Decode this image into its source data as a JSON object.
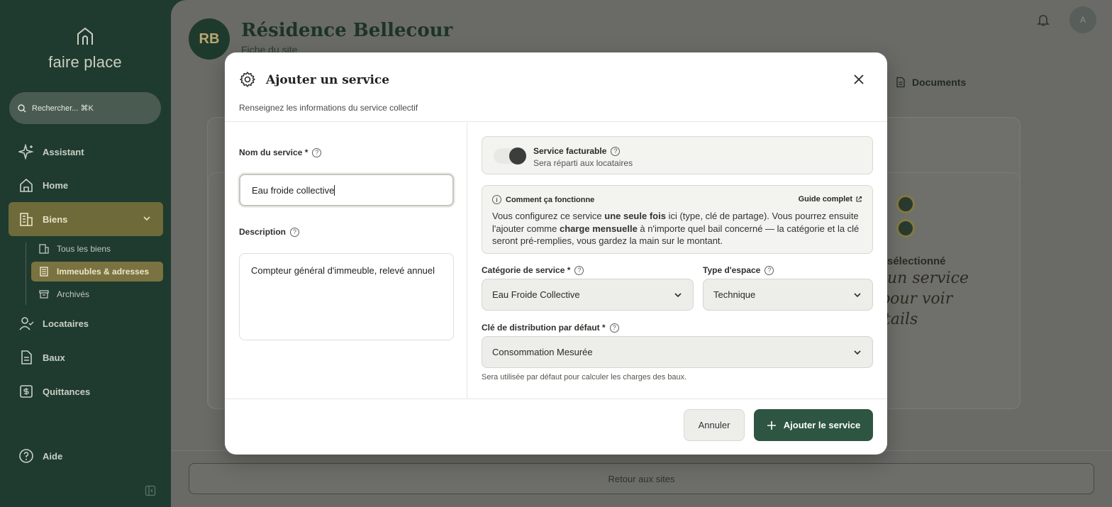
{
  "sidebar": {
    "logo_text": "faire place",
    "search_placeholder": "Rechercher... ⌘K",
    "nav": [
      {
        "label": "Assistant",
        "icon": "sparkle-icon"
      },
      {
        "label": "Home",
        "icon": "home-icon"
      },
      {
        "label": "Biens",
        "icon": "building-icon"
      },
      {
        "label": "Locataires",
        "icon": "user-icon"
      },
      {
        "label": "Baux",
        "icon": "document-icon"
      },
      {
        "label": "Quittances",
        "icon": "receipt-icon"
      },
      {
        "label": "Aide",
        "icon": "help-icon"
      }
    ],
    "sub": [
      {
        "label": "Tous les biens"
      },
      {
        "label": "Immeubles & adresses"
      },
      {
        "label": "Archivés"
      }
    ]
  },
  "header": {
    "avatar_initials": "RB",
    "title": "Résidence Bellecour",
    "subtitle": "Fiche du site",
    "user_initial": "A",
    "tab_documents": "Documents"
  },
  "background": {
    "empty_bold": "sélectionné",
    "empty_script_1": "un service",
    "empty_script_2": "pour voir",
    "empty_script_3": "tails",
    "back_button": "Retour aux sites"
  },
  "modal": {
    "title": "Ajouter un service",
    "subtitle": "Renseignez les informations du service collectif",
    "name_label": "Nom du service *",
    "name_value": "Eau froide collective",
    "description_label": "Description",
    "description_value": "Compteur général d'immeuble, relevé annuel",
    "billable_label": "Service facturable",
    "billable_sub": "Sera réparti aux locataires",
    "info_title": "Comment ça fonctionne",
    "info_guide": "Guide complet",
    "info_text_1": "Vous configurez ce service ",
    "info_bold_1": "une seule fois",
    "info_text_2": " ici (type, clé de partage). Vous pourrez ensuite l'ajouter comme ",
    "info_bold_2": "charge mensuelle",
    "info_text_3": " à n'importe quel bail concerné — la catégorie et la clé seront pré-remplies, vous gardez la main sur le montant.",
    "category_label": "Catégorie de service *",
    "category_value": "Eau Froide Collective",
    "space_label": "Type d'espace",
    "space_value": "Technique",
    "key_label": "Clé de distribution par défaut *",
    "key_value": "Consommation Mesurée",
    "key_hint": "Sera utilisée par défaut pour calculer les charges des baux.",
    "cancel": "Annuler",
    "submit": "Ajouter le service"
  }
}
